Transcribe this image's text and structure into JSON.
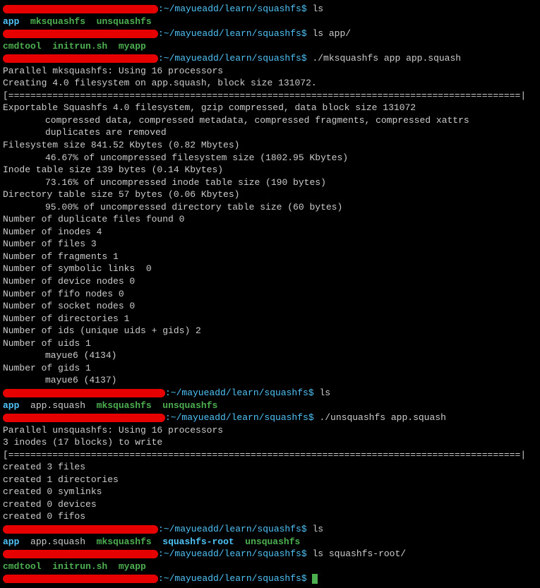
{
  "prompt_path": ":~/mayueadd/learn/squashfs$",
  "cmds": {
    "ls": "ls",
    "ls_app": "ls app/",
    "mksquashfs": "./mksquashfs app app.squash",
    "unsquashfs": "./unsquashfs app.squash",
    "ls_root": "ls squashfs-root/"
  },
  "listing1": {
    "dir": "app",
    "exec1": "mksquashfs",
    "exec2": "unsquashfs"
  },
  "listing_app": {
    "exec1": "cmdtool",
    "exec2": "initrun.sh",
    "exec3": "myapp"
  },
  "mk_output": [
    "Parallel mksquashfs: Using 16 processors",
    "Creating 4.0 filesystem on app.squash, block size 131072.",
    "[=============================================================================================|",
    "Exportable Squashfs 4.0 filesystem, gzip compressed, data block size 131072",
    "compressed data, compressed metadata, compressed fragments, compressed xattrs",
    "duplicates are removed",
    "Filesystem size 841.52 Kbytes (0.82 Mbytes)",
    "46.67% of uncompressed filesystem size (1802.95 Kbytes)",
    "Inode table size 139 bytes (0.14 Kbytes)",
    "73.16% of uncompressed inode table size (190 bytes)",
    "Directory table size 57 bytes (0.06 Kbytes)",
    "95.00% of uncompressed directory table size (60 bytes)",
    "Number of duplicate files found 0",
    "Number of inodes 4",
    "Number of files 3",
    "Number of fragments 1",
    "Number of symbolic links  0",
    "Number of device nodes 0",
    "Number of fifo nodes 0",
    "Number of socket nodes 0",
    "Number of directories 1",
    "Number of ids (unique uids + gids) 2",
    "Number of uids 1",
    "mayue6 (4134)",
    "Number of gids 1",
    "mayue6 (4137)"
  ],
  "listing3": {
    "dir": "app",
    "file": "app.squash",
    "exec1": "mksquashfs",
    "exec2": "unsquashfs"
  },
  "un_output": [
    "Parallel unsquashfs: Using 16 processors",
    "3 inodes (17 blocks) to write",
    "",
    "[=============================================================================================|",
    "created 3 files",
    "created 1 directories",
    "created 0 symlinks",
    "created 0 devices",
    "created 0 fifos"
  ],
  "listing4": {
    "dir1": "app",
    "file": "app.squash",
    "exec1": "mksquashfs",
    "dir2": "squashfs-root",
    "exec2": "unsquashfs"
  }
}
